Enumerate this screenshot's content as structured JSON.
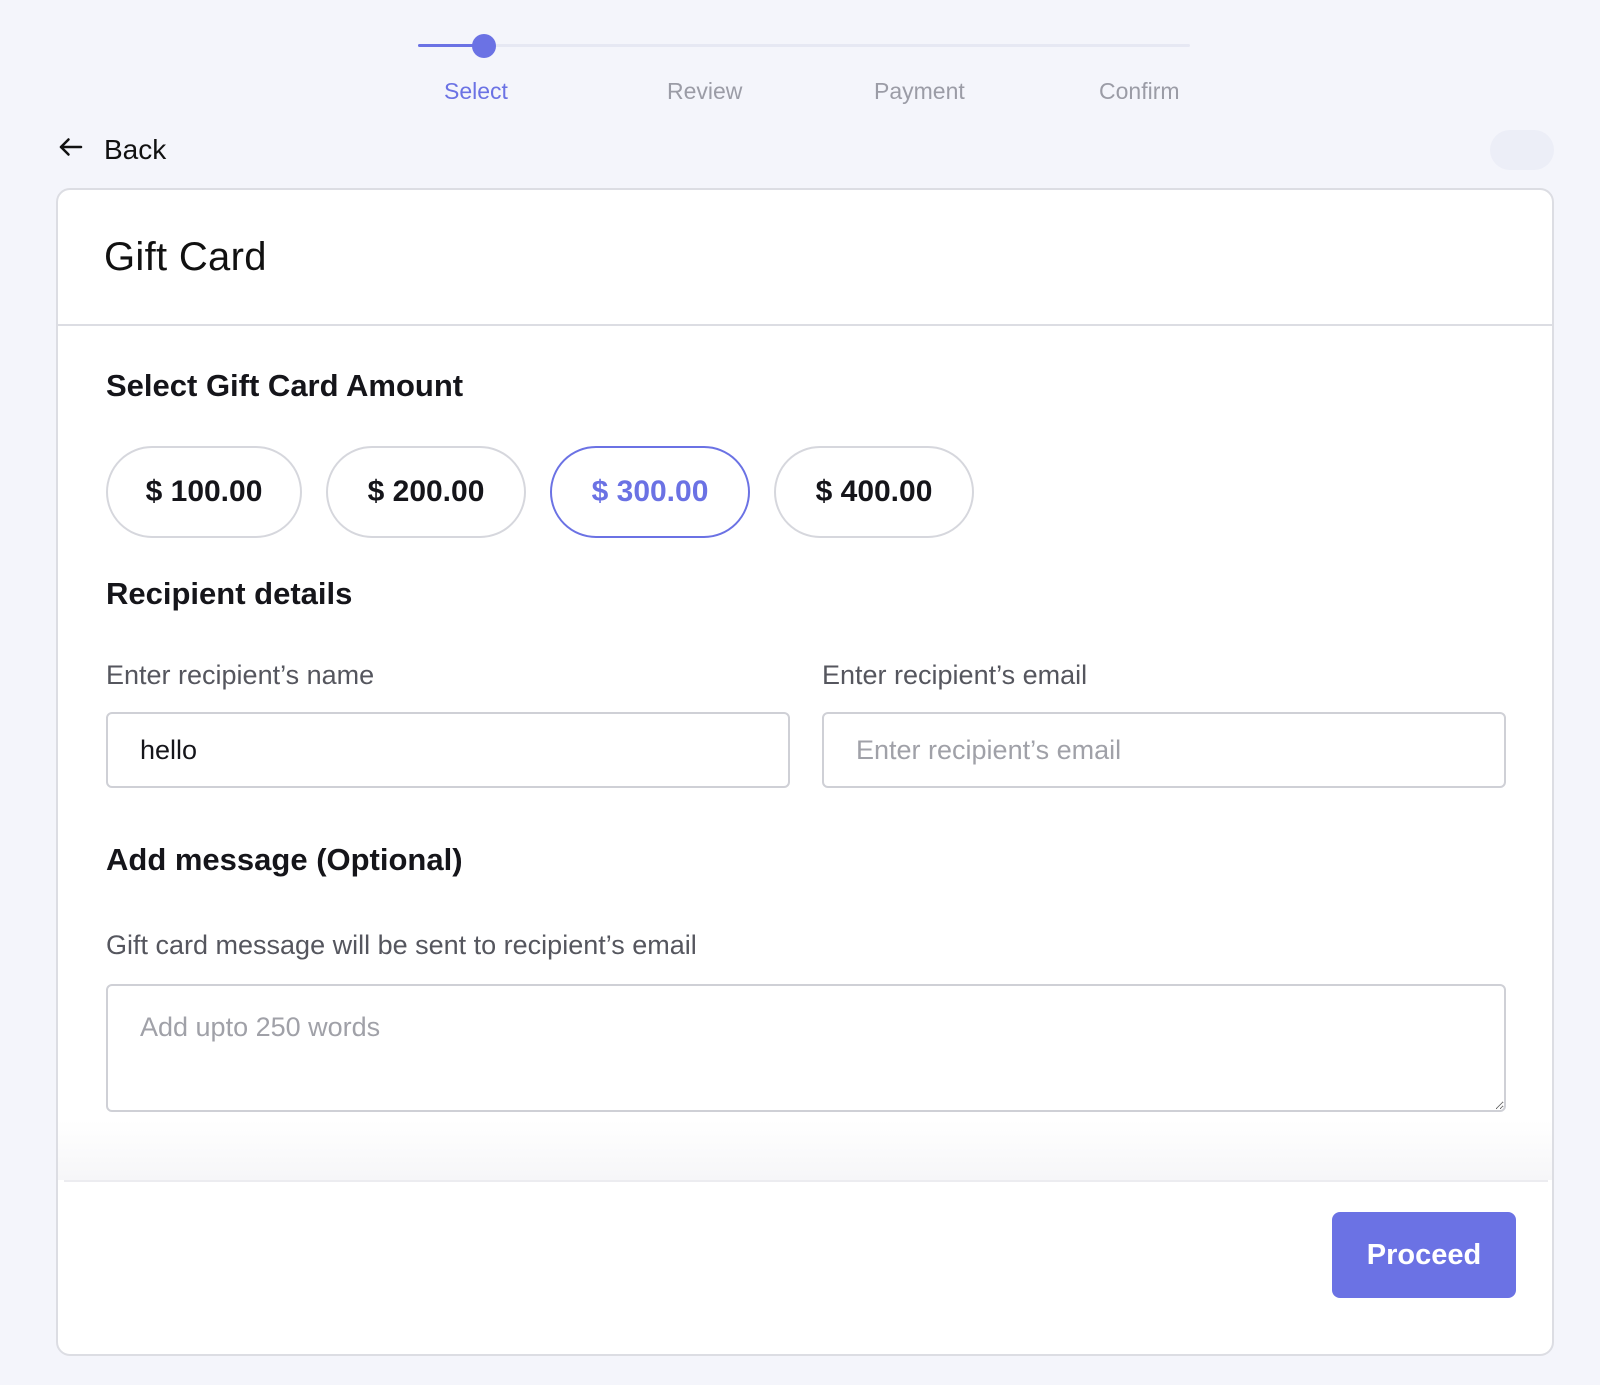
{
  "stepper": {
    "steps": [
      {
        "label": "Select",
        "active": true
      },
      {
        "label": "Review",
        "active": false
      },
      {
        "label": "Payment",
        "active": false
      },
      {
        "label": "Confirm",
        "active": false
      }
    ],
    "accent_color": "#6b72e4"
  },
  "back": {
    "label": "Back",
    "icon": "arrow-left-icon"
  },
  "card": {
    "title": "Gift Card",
    "amount_section": {
      "title": "Select Gift Card Amount",
      "options": [
        "$ 100.00",
        "$ 200.00",
        "$ 300.00",
        "$ 400.00"
      ],
      "selected": "$ 300.00"
    },
    "recipient_section": {
      "title": "Recipient details",
      "name_label": "Enter recipient’s name",
      "name_value": "hello",
      "email_label": "Enter recipient’s email",
      "email_placeholder": "Enter recipient’s email",
      "email_value": ""
    },
    "message_section": {
      "title": "Add message (Optional)",
      "hint": "Gift card message will be sent to recipient’s email",
      "placeholder": "Add upto 250 words"
    },
    "proceed_label": "Proceed"
  }
}
